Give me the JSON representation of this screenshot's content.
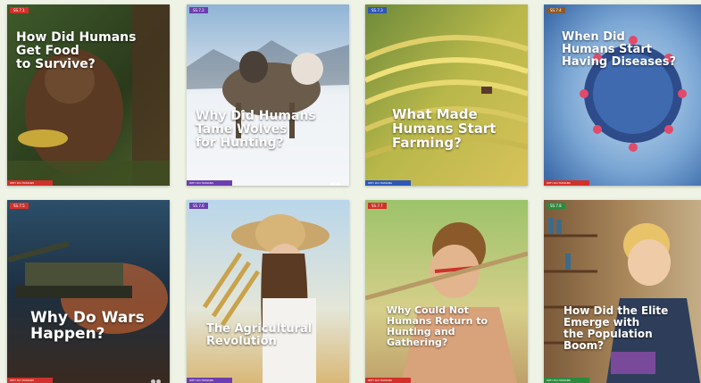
{
  "cards": [
    {
      "title": "How Did Humans\nGet Food\nto Survive?",
      "tag": "SS.7.1",
      "strip": "WHY DO HUMANS",
      "tag_color": "#d1312a",
      "strip_color": "#d1312a"
    },
    {
      "title": "Why Did Humans\nTame Wolves\nfor Hunting?",
      "tag": "SS.7.2",
      "strip": "WHY DO HUMANS",
      "tag_color": "#6c3fb0",
      "strip_color": "#6c3fb0"
    },
    {
      "title": "What Made\nHumans Start\nFarming?",
      "tag": "SS.7.3",
      "strip": "WHY DO HUMANS",
      "tag_color": "#2f56b8",
      "strip_color": "#2f56b8"
    },
    {
      "title": "When Did\nHumans Start\nHaving Diseases?",
      "tag": "SS.7.4",
      "strip": "WHY DO HUMANS",
      "tag_color": "#8a5a2a",
      "strip_color": "#d1312a"
    },
    {
      "title": "Why Do Wars\nHappen?",
      "tag": "SS.7.5",
      "strip": "WHY DO HUMANS",
      "tag_color": "#d1312a",
      "strip_color": "#d1312a"
    },
    {
      "title": "The Agricultural\nRevolution",
      "tag": "SS.7.6",
      "strip": "WHY DO HUMANS",
      "tag_color": "#6c3fb0",
      "strip_color": "#6c3fb0"
    },
    {
      "title": "Why Could Not\nHumans Return to\nHunting and\nGathering?",
      "tag": "SS.7.7",
      "strip": "WHY DO HUMANS",
      "tag_color": "#d1312a",
      "strip_color": "#d1312a"
    },
    {
      "title": "How Did the Elite\nEmerge with\nthe Population\nBoom?",
      "tag": "SS.7.8",
      "strip": "WHY DO HUMANS",
      "tag_color": "#2b8a3e",
      "strip_color": "#2b8a3e"
    }
  ]
}
